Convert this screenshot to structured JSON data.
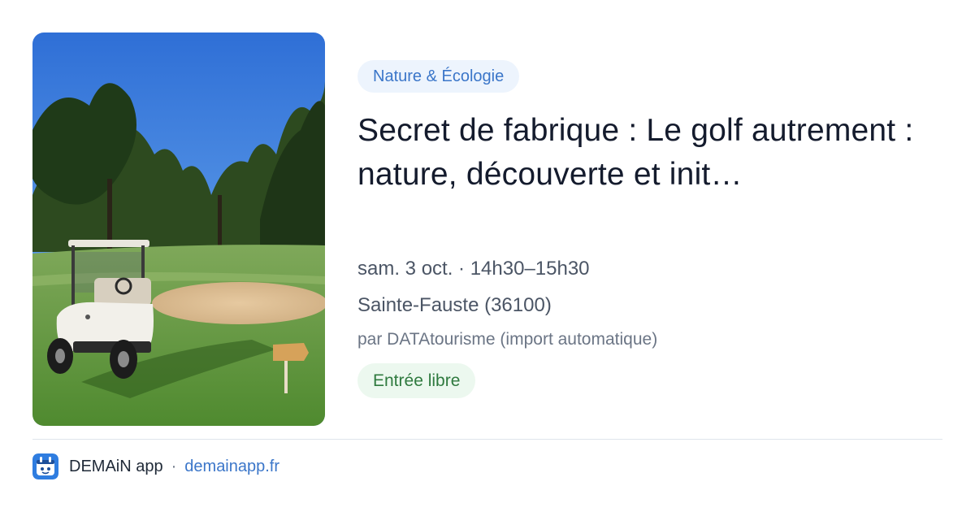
{
  "card": {
    "image_icon": "golf-course-photo",
    "category": "Nature & Écologie",
    "title": "Secret de fabrique : Le golf autrement : nature, découverte et init…",
    "when": "sam. 3 oct. · 14h30–15h30",
    "where": "Sainte-Fauste (36100)",
    "source": "par DATAtourisme (import automatique)",
    "price": "Entrée libre"
  },
  "footer": {
    "logo_icon": "demain-app-logo",
    "app_name": "DEMAiN app",
    "separator": "·",
    "url": "demainapp.fr"
  },
  "colors": {
    "category_bg": "#edf4fd",
    "category_text": "#3b76c9",
    "price_bg": "#ecf8ef",
    "price_text": "#2f7a3f",
    "link": "#3b76c9"
  }
}
